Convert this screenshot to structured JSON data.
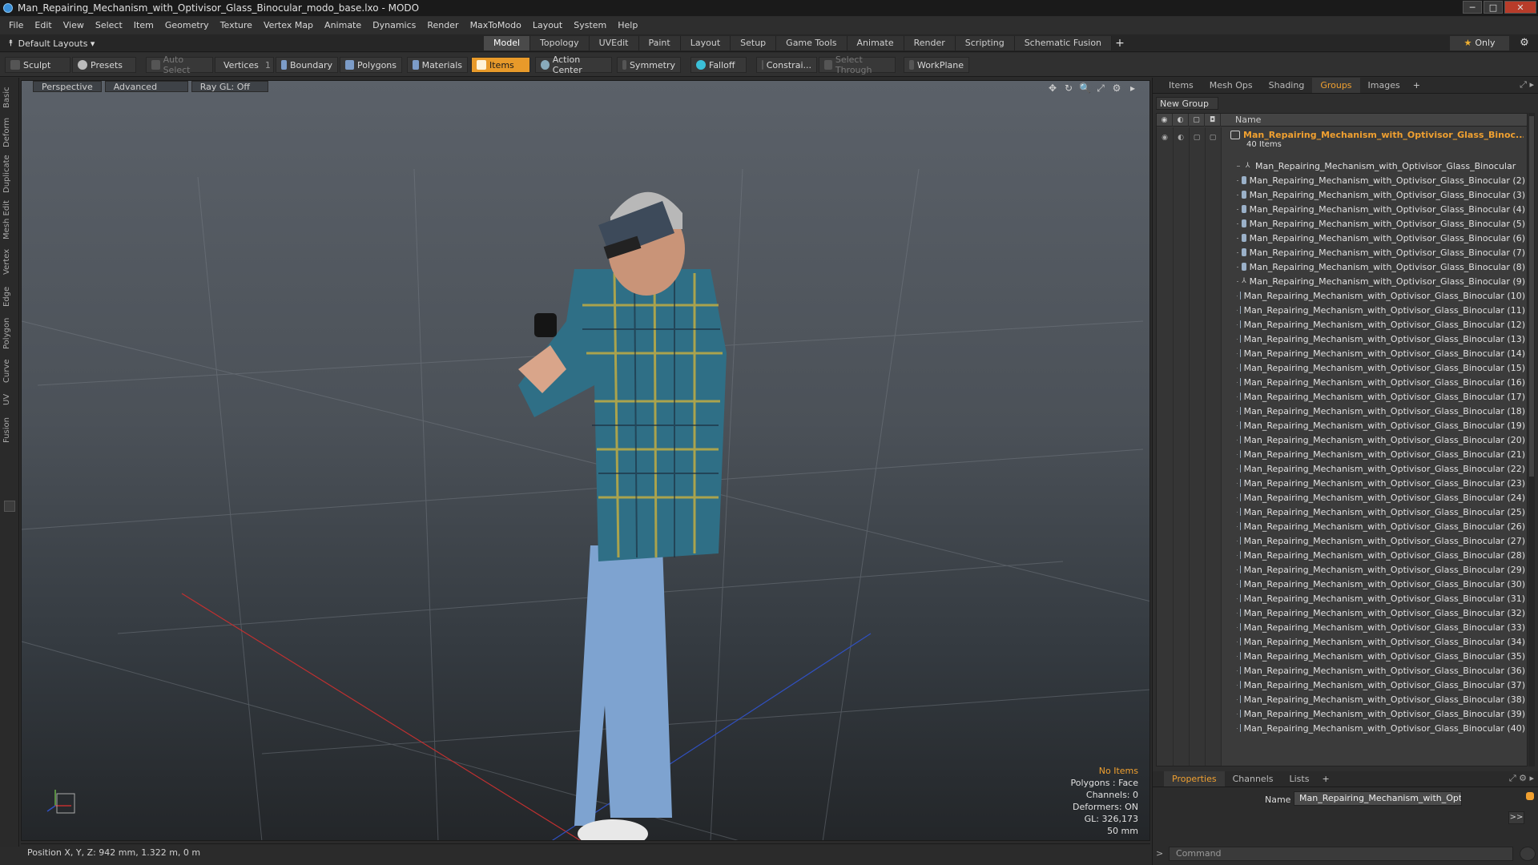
{
  "window": {
    "title": "Man_Repairing_Mechanism_with_Optivisor_Glass_Binocular_modo_base.lxo - MODO",
    "minimize": "─",
    "maximize": "□",
    "close": "✕"
  },
  "menu": [
    "File",
    "Edit",
    "View",
    "Select",
    "Item",
    "Geometry",
    "Texture",
    "Vertex Map",
    "Animate",
    "Dynamics",
    "Render",
    "MaxToModo",
    "Layout",
    "System",
    "Help"
  ],
  "layout_bar": {
    "layout_select": "Default Layouts ▾",
    "tabs": [
      "Model",
      "Topology",
      "UVEdit",
      "Paint",
      "Layout",
      "Setup",
      "Game Tools",
      "Animate",
      "Render",
      "Scripting",
      "Schematic Fusion"
    ],
    "active_tab": "Model",
    "add_tab": "+",
    "only_label": "Only",
    "star": "★",
    "gear": "⚙"
  },
  "toolbar": {
    "sculpt": "Sculpt",
    "presets": "Presets",
    "auto_select": "Auto Select",
    "vertices": "Vertices",
    "vertices_count": "1",
    "boundary": "Boundary",
    "polygons": "Polygons",
    "materials": "Materials",
    "items": "Items",
    "action_center": "Action Center",
    "symmetry": "Symmetry",
    "falloff": "Falloff",
    "constraints": "Constrai...",
    "select_through": "Select Through",
    "workplane": "WorkPlane"
  },
  "left_tabs": [
    "Basic",
    "Deform",
    "Duplicate",
    "Mesh Edit",
    "Vertex",
    "Edge",
    "Polygon",
    "Curve",
    "UV",
    "Fusion"
  ],
  "viewport": {
    "view_mode": "Perspective",
    "shading": "Advanced",
    "raygl": "Ray GL: Off",
    "icons": [
      "✥",
      "↻",
      "🔍",
      "⤢",
      "⚙",
      "▸"
    ],
    "info": {
      "selection": "No Items",
      "polygons": "Polygons : Face",
      "channels": "Channels: 0",
      "deformers": "Deformers: ON",
      "gl": "GL: 326,173",
      "scale": "50 mm"
    }
  },
  "status": {
    "position": "Position X, Y, Z:  942 mm, 1.322 m, 0 m"
  },
  "panel": {
    "tabs": [
      "Items",
      "Mesh Ops",
      "Shading",
      "Groups",
      "Images"
    ],
    "active_tab": "Groups",
    "add_tab": "+",
    "new_group": "New Group",
    "name_header": "Name",
    "group": {
      "name": "Man_Repairing_Mechanism_with_Optivisor_Glass_Binoc...",
      "count": "40 Items"
    },
    "items": [
      "Man_Repairing_Mechanism_with_Optivisor_Glass_Binocular",
      "Man_Repairing_Mechanism_with_Optivisor_Glass_Binocular (2)",
      "Man_Repairing_Mechanism_with_Optivisor_Glass_Binocular (3)",
      "Man_Repairing_Mechanism_with_Optivisor_Glass_Binocular (4)",
      "Man_Repairing_Mechanism_with_Optivisor_Glass_Binocular (5)",
      "Man_Repairing_Mechanism_with_Optivisor_Glass_Binocular (6)",
      "Man_Repairing_Mechanism_with_Optivisor_Glass_Binocular (7)",
      "Man_Repairing_Mechanism_with_Optivisor_Glass_Binocular (8)",
      "Man_Repairing_Mechanism_with_Optivisor_Glass_Binocular (9)",
      "Man_Repairing_Mechanism_with_Optivisor_Glass_Binocular (10)",
      "Man_Repairing_Mechanism_with_Optivisor_Glass_Binocular (11)",
      "Man_Repairing_Mechanism_with_Optivisor_Glass_Binocular (12)",
      "Man_Repairing_Mechanism_with_Optivisor_Glass_Binocular (13)",
      "Man_Repairing_Mechanism_with_Optivisor_Glass_Binocular (14)",
      "Man_Repairing_Mechanism_with_Optivisor_Glass_Binocular (15)",
      "Man_Repairing_Mechanism_with_Optivisor_Glass_Binocular (16)",
      "Man_Repairing_Mechanism_with_Optivisor_Glass_Binocular (17)",
      "Man_Repairing_Mechanism_with_Optivisor_Glass_Binocular (18)",
      "Man_Repairing_Mechanism_with_Optivisor_Glass_Binocular (19)",
      "Man_Repairing_Mechanism_with_Optivisor_Glass_Binocular (20)",
      "Man_Repairing_Mechanism_with_Optivisor_Glass_Binocular (21)",
      "Man_Repairing_Mechanism_with_Optivisor_Glass_Binocular (22)",
      "Man_Repairing_Mechanism_with_Optivisor_Glass_Binocular (23)",
      "Man_Repairing_Mechanism_with_Optivisor_Glass_Binocular (24)",
      "Man_Repairing_Mechanism_with_Optivisor_Glass_Binocular (25)",
      "Man_Repairing_Mechanism_with_Optivisor_Glass_Binocular (26)",
      "Man_Repairing_Mechanism_with_Optivisor_Glass_Binocular (27)",
      "Man_Repairing_Mechanism_with_Optivisor_Glass_Binocular (28)",
      "Man_Repairing_Mechanism_with_Optivisor_Glass_Binocular (29)",
      "Man_Repairing_Mechanism_with_Optivisor_Glass_Binocular (30)",
      "Man_Repairing_Mechanism_with_Optivisor_Glass_Binocular (31)",
      "Man_Repairing_Mechanism_with_Optivisor_Glass_Binocular (32)",
      "Man_Repairing_Mechanism_with_Optivisor_Glass_Binocular (33)",
      "Man_Repairing_Mechanism_with_Optivisor_Glass_Binocular (34)",
      "Man_Repairing_Mechanism_with_Optivisor_Glass_Binocular (35)",
      "Man_Repairing_Mechanism_with_Optivisor_Glass_Binocular (36)",
      "Man_Repairing_Mechanism_with_Optivisor_Glass_Binocular (37)",
      "Man_Repairing_Mechanism_with_Optivisor_Glass_Binocular (38)",
      "Man_Repairing_Mechanism_with_Optivisor_Glass_Binocular (39)",
      "Man_Repairing_Mechanism_with_Optivisor_Glass_Binocular (40)"
    ],
    "locator_items": [
      0,
      8
    ]
  },
  "properties": {
    "tabs": [
      "Properties",
      "Channels",
      "Lists"
    ],
    "active_tab": "Properties",
    "add_tab": "+",
    "name_label": "Name",
    "name_value": "Man_Repairing_Mechanism_with_Optivisor_Glass_Binoc",
    "more": ">>",
    "command_placeholder": "Command",
    "command_arrow": ">"
  },
  "colors": {
    "accent": "#f0a030",
    "close_button": "#b83c2a",
    "viewport_top": "#5b6169",
    "viewport_bottom": "#232629"
  }
}
